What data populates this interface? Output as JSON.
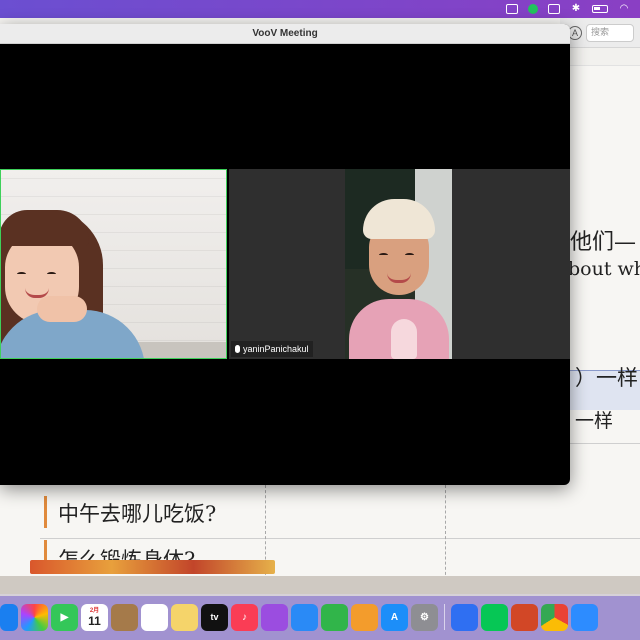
{
  "window": {
    "title": "VooV Meeting"
  },
  "participants": [
    {
      "name": ""
    },
    {
      "name": "yaninPanichakul"
    }
  ],
  "document": {
    "search_placeholder": "搜索",
    "line1": "他们—",
    "line2": "bout wh",
    "row1": "）一样",
    "row2": "一样",
    "cell1": "中午去哪儿吃饭?",
    "cell2": "怎么锻炼身体?"
  },
  "dock": {
    "calendar_month": "2月",
    "calendar_day": "11",
    "tv_label": "tv"
  },
  "colors": {
    "accent_green": "#3ed05a",
    "menubar_purple": "#6b4fd1"
  }
}
